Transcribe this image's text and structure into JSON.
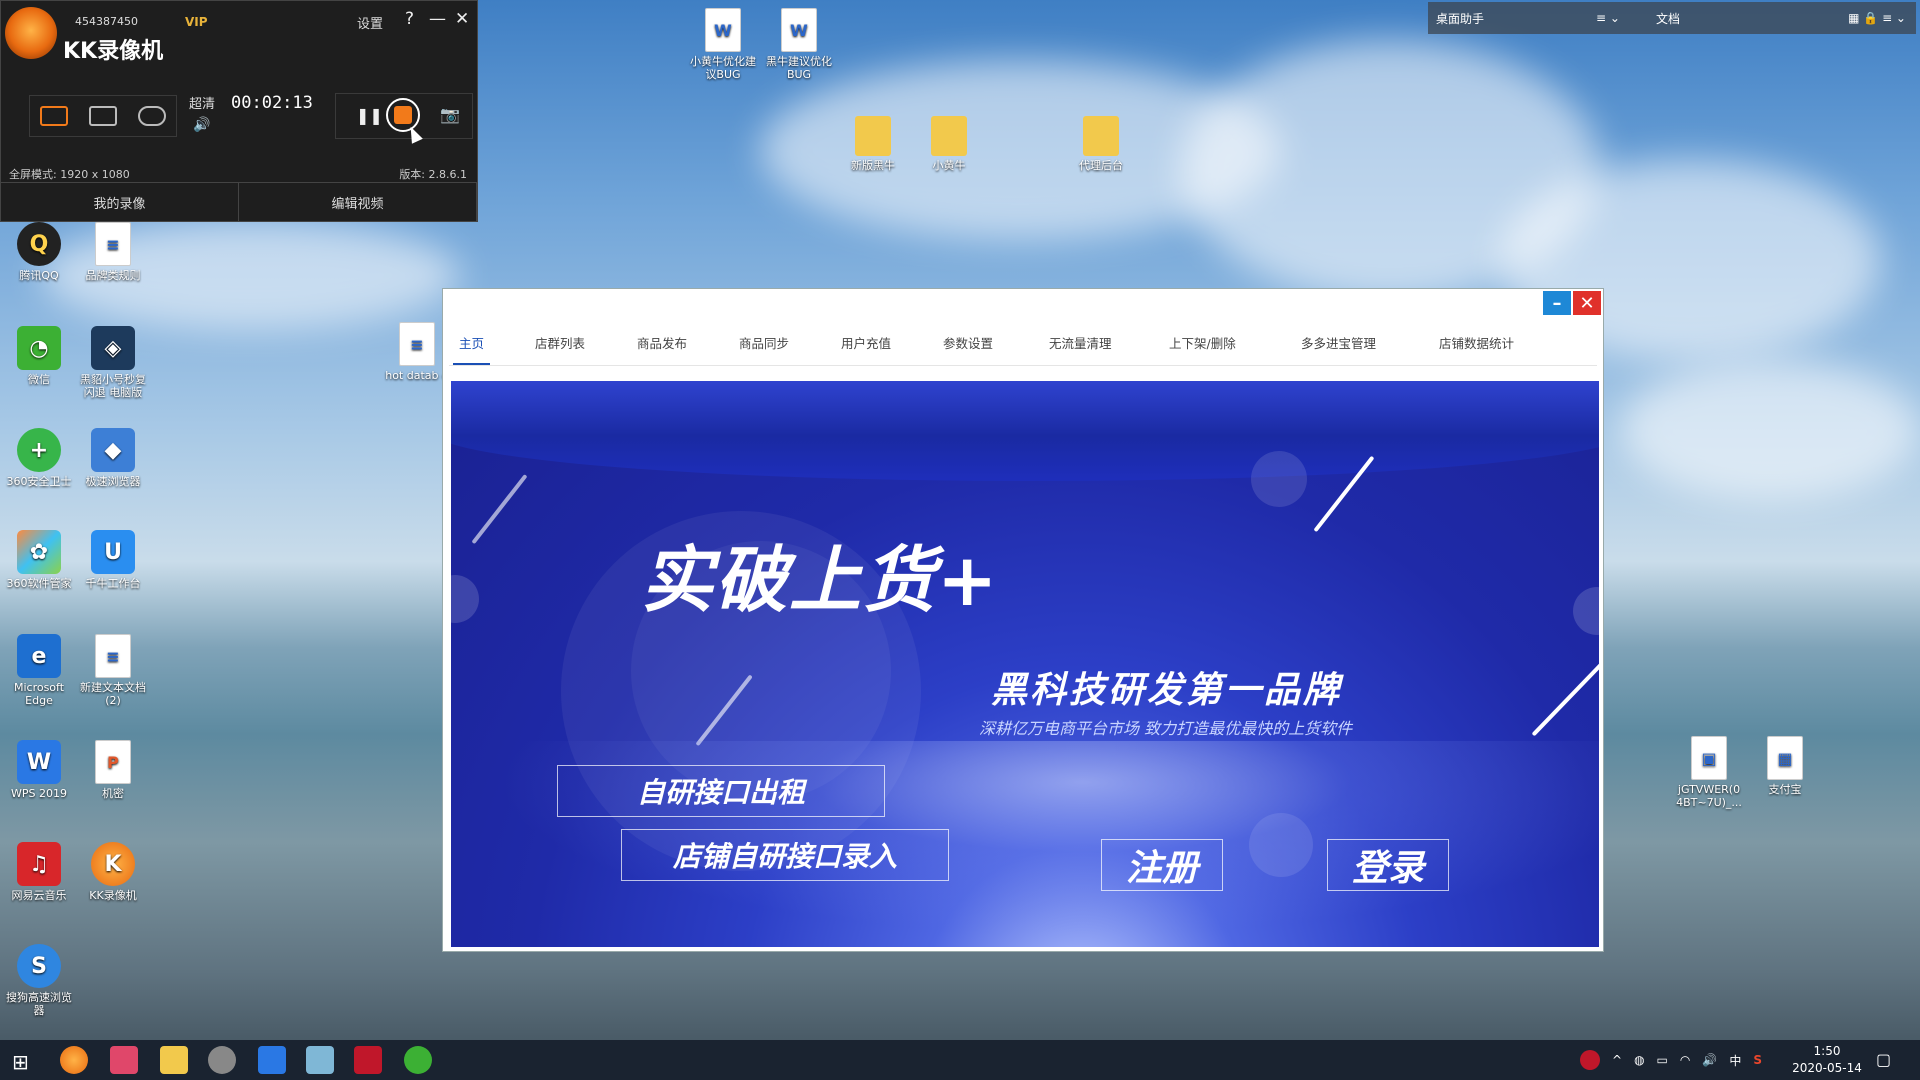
{
  "recorder": {
    "account": "454387450",
    "vip": "VIP",
    "title": "KK录像机",
    "settings": "设置",
    "help": "?",
    "minimize": "—",
    "close": "✕",
    "quality": "超清",
    "timer": "00:02:13",
    "mode_text": "全屏模式: 1920 x 1080",
    "version": "版本: 2.8.6.1",
    "tab_my_recordings": "我的录像",
    "tab_edit_video": "编辑视频",
    "record_color": "#f27a1a"
  },
  "assistant": {
    "label": "桌面助手",
    "doc_label": "文档"
  },
  "desktop_icons": [
    {
      "label": "腾讯QQ"
    },
    {
      "label": "品牌类规则"
    },
    {
      "label": "微信"
    },
    {
      "label": "黑貂小号秒复闪退 电脑版"
    },
    {
      "label": "360安全卫士"
    },
    {
      "label": "极速浏览器"
    },
    {
      "label": "360软件管家"
    },
    {
      "label": "千牛工作台"
    },
    {
      "label": "Microsoft Edge"
    },
    {
      "label": "新建文本文档 (2)"
    },
    {
      "label": "WPS 2019"
    },
    {
      "label": "机密"
    },
    {
      "label": "网易云音乐"
    },
    {
      "label": "KK录像机"
    },
    {
      "label": "搜狗高速浏览器"
    },
    {
      "label": "hot datab e"
    },
    {
      "label": "小黄牛优化建议BUG"
    },
    {
      "label": "黑牛建议优化BUG"
    },
    {
      "label": "新版黑牛"
    },
    {
      "label": "小黄牛"
    },
    {
      "label": "代理后台"
    },
    {
      "label": "jGTVWER(0 4BT~7U)_..."
    },
    {
      "label": "支付宝"
    }
  ],
  "app": {
    "nav": [
      "主页",
      "店群列表",
      "商品发布",
      "商品同步",
      "用户充值",
      "参数设置",
      "无流量清理",
      "上下架/删除",
      "多多进宝管理",
      "店铺数据统计"
    ],
    "active_tab": "主页",
    "banner": {
      "title": "实破上货+",
      "brand": "黑科技研发第一品牌",
      "subtitle": "深耕亿万电商平台市场  致力打造最优最快的上货软件",
      "btn_rent": "自研接口出租",
      "btn_import": "店铺自研接口录入",
      "btn_register": "注册",
      "btn_login": "登录"
    },
    "accent": "#1a4fb5",
    "winbtn_min_color": "#1e88d6",
    "winbtn_close_color": "#e0312b"
  },
  "taskbar": {
    "time": "1:50",
    "date": "2020-05-14",
    "ime": "中"
  }
}
